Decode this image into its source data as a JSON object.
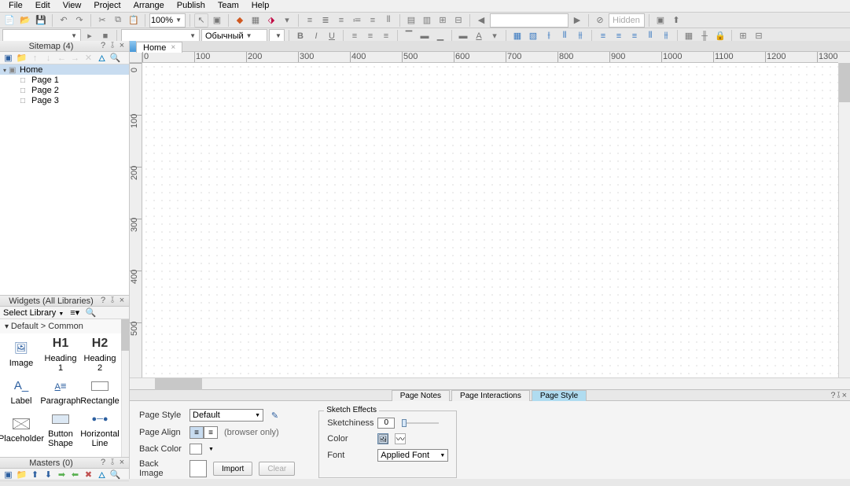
{
  "menu": [
    "File",
    "Edit",
    "View",
    "Project",
    "Arrange",
    "Publish",
    "Team",
    "Help"
  ],
  "toolbar1": {
    "zoom": "100%",
    "hidden_label": "Hidden"
  },
  "toolbar2": {
    "drop_placeholder": "",
    "style_select": "Обычный"
  },
  "sitemap": {
    "title": "Sitemap (4)",
    "root": "Home",
    "pages": [
      "Page 1",
      "Page 2",
      "Page 3"
    ]
  },
  "widgets": {
    "title": "Widgets (All Libraries)",
    "select_lib": "Select Library",
    "group": "Default > Common",
    "items": [
      {
        "label": "Image",
        "icon": "image"
      },
      {
        "label": "Heading 1",
        "icon": "H1"
      },
      {
        "label": "Heading 2",
        "icon": "H2"
      },
      {
        "label": "Label",
        "icon": "label"
      },
      {
        "label": "Paragraph",
        "icon": "para"
      },
      {
        "label": "Rectangle",
        "icon": "rect"
      },
      {
        "label": "Placeholder",
        "icon": "ph"
      },
      {
        "label": "Button Shape",
        "icon": "btn"
      },
      {
        "label": "Horizontal Line",
        "icon": "hline"
      }
    ]
  },
  "masters": {
    "title": "Masters (0)"
  },
  "doc_tab": "Home",
  "ruler_ticks": [
    0,
    100,
    200,
    300,
    400,
    500,
    600,
    700,
    800,
    900,
    1000,
    1100,
    1200,
    1300
  ],
  "vruler_ticks": [
    0,
    100,
    200,
    300,
    400,
    500
  ],
  "props": {
    "tabs": [
      "Page Notes",
      "Page Interactions",
      "Page Style"
    ],
    "active": 2,
    "labels": {
      "page_style": "Page Style",
      "page_align": "Page Align",
      "back_color": "Back Color",
      "back_image": "Back Image",
      "browser_only": "(browser only)",
      "import": "Import",
      "clear": "Clear",
      "default": "Default"
    },
    "sketch": {
      "legend": "Sketch Effects",
      "sketchiness": "Sketchiness",
      "sketch_val": "0",
      "color": "Color",
      "font": "Font",
      "font_value": "Applied Font"
    }
  }
}
